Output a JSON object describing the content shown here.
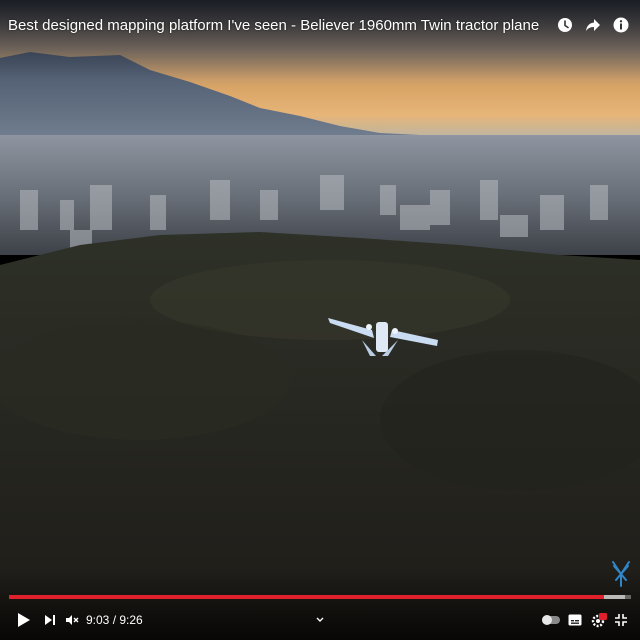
{
  "video": {
    "title": "Best designed mapping platform I've seen - Believer 1960mm Twin tractor plane",
    "current_time": "9:03",
    "duration": "9:26",
    "time_separator": " / ",
    "progress_fraction": 0.957,
    "buffered_fraction": 0.99
  },
  "icons": {
    "watch_later": "clock-icon",
    "share": "share-arrow-icon",
    "info": "info-icon",
    "play": "play-icon",
    "next": "next-icon",
    "mute": "volume-muted-icon",
    "chevron": "chevron-down-icon",
    "autoplay": "autoplay-toggle-icon",
    "subtitles": "subtitles-icon",
    "settings": "gear-icon",
    "fullscreen": "exit-fullscreen-icon",
    "watermark": "channel-watermark-icon"
  },
  "colors": {
    "progress_played": "#e0202a",
    "settings_badge": "#e0202a",
    "watermark": "#2f86c8"
  }
}
